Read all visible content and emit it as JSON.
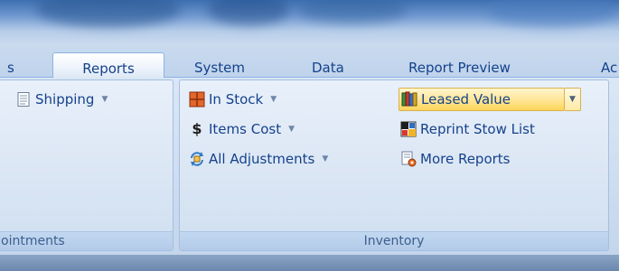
{
  "tabs": [
    "s",
    "Reports",
    "System",
    "Data",
    "Report Preview",
    "Ac"
  ],
  "groups": {
    "left": {
      "shipping_label": "Shipping",
      "label": "ointments"
    },
    "inventory": {
      "label": "Inventory",
      "in_stock": "In Stock",
      "items_cost": "Items Cost",
      "all_adjustments": "All Adjustments",
      "leased_value": "Leased Value",
      "reprint_stow_list": "Reprint Stow List",
      "more_reports": "More Reports"
    }
  },
  "icons": {
    "shipping": "document-icon",
    "in_stock": "boxes-icon",
    "items_cost": "dollar-icon",
    "all_adjustments": "adjust-icon",
    "leased_value": "books-icon",
    "reprint_stow_list": "stow-list-icon",
    "more_reports": "report-gear-icon"
  },
  "symbols": {
    "dollar": "$",
    "dropdown": "▼"
  },
  "colors": {
    "text": "#15428b",
    "hover_fill": "#ffd65a",
    "ribbon": "#dbe7f5"
  }
}
